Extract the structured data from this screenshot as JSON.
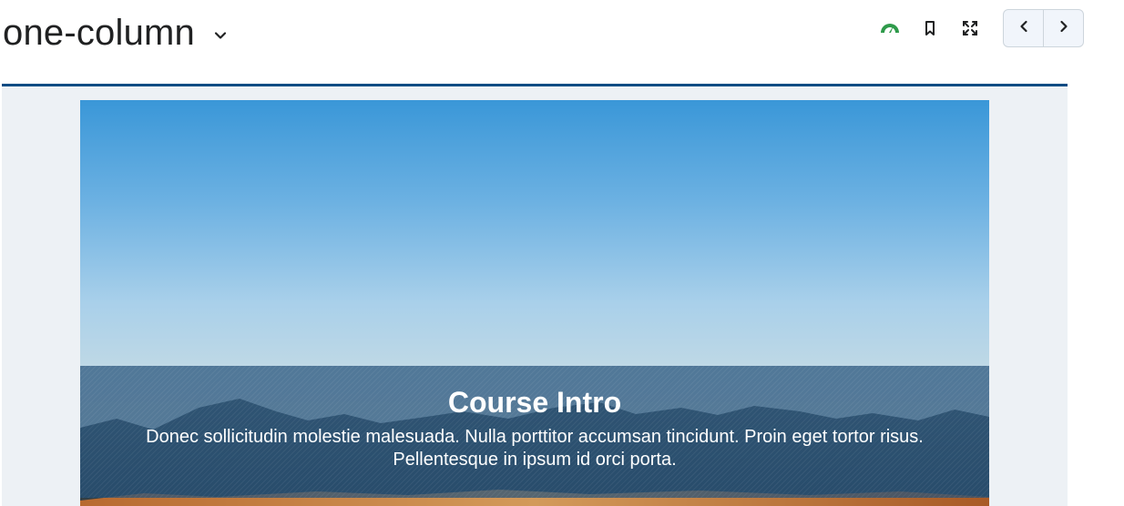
{
  "header": {
    "title": "one-column",
    "icons": {
      "title_dropdown": "chevron-down-icon",
      "progress": "speedometer-icon",
      "bookmark": "bookmark-icon",
      "fullscreen": "fullscreen-icon",
      "previous": "chevron-left-icon",
      "next": "chevron-right-icon"
    }
  },
  "colors": {
    "progress_icon": "#2e9a4a",
    "divider": "#0e4c84",
    "content_background": "#edf1f5",
    "overlay": "#26527a"
  },
  "hero": {
    "title": "Course Intro",
    "description": "Donec sollicitudin molestie malesuada. Nulla porttitor accumsan tincidunt. Proin eget tortor risus. Pellentesque in ipsum id orci porta."
  }
}
